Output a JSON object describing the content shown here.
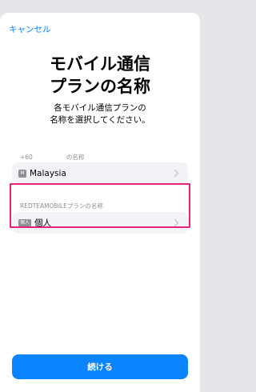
{
  "header": {
    "cancel_label": "キャンセル"
  },
  "main": {
    "title_line1": "モバイル通信",
    "title_line2": "プランの名称",
    "subtitle_line1": "各モバイル通信プランの",
    "subtitle_line2": "名称を選択してください。"
  },
  "lines": [
    {
      "number_label": "+60",
      "label_suffix": "の名称",
      "badge": "M",
      "value": "Malaysia"
    },
    {
      "label": "REDTEAMOBILEプランの名称",
      "badge": "個人",
      "value": "個人"
    }
  ],
  "footer": {
    "continue_label": "続ける"
  },
  "colors": {
    "accent": "#0a84ff",
    "highlight": "#e5257a"
  },
  "icons": {
    "row_arrow": "chevron-right-icon"
  }
}
